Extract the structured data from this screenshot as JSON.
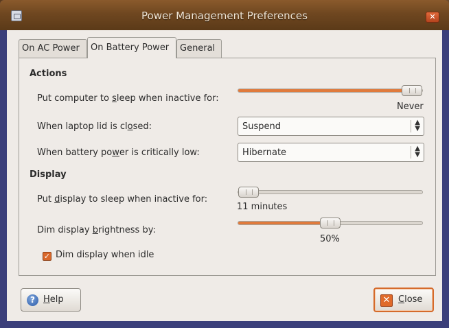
{
  "window": {
    "title": "Power Management Preferences",
    "close_glyph": "✕"
  },
  "tabs": [
    {
      "label": "On AC Power"
    },
    {
      "label": "On Battery Power"
    },
    {
      "label": "General"
    }
  ],
  "actions": {
    "heading": "Actions",
    "sleep": {
      "label_pre": "Put computer to ",
      "label_u": "s",
      "label_post": "leep when inactive for:",
      "value": "Never",
      "level": 1.0
    },
    "lid": {
      "label_pre": "When laptop lid is cl",
      "label_u": "o",
      "label_post": "sed:",
      "selected": "Suspend"
    },
    "critical": {
      "label_pre": "When battery po",
      "label_u": "w",
      "label_post": "er is critically low:",
      "selected": "Hibernate"
    }
  },
  "display": {
    "heading": "Display",
    "sleep": {
      "label_pre": "Put ",
      "label_u": "d",
      "label_post": "isplay to sleep when inactive for:",
      "value": "11 minutes",
      "level": 0.0
    },
    "dim": {
      "label_pre": "Dim display ",
      "label_u": "b",
      "label_post": "rightness by:",
      "value": "50%",
      "level": 0.5
    },
    "idle": {
      "label": "Dim display when idle",
      "checked": true,
      "check_glyph": "✓"
    }
  },
  "buttons": {
    "help_pre": "",
    "help_u": "H",
    "help_post": "elp",
    "help_icon_glyph": "?",
    "close_pre": "",
    "close_u": "C",
    "close_post": "lose",
    "close_icon_glyph": "✕"
  },
  "colors": {
    "accent": "#e07a3c",
    "titlebar": "#6f4720"
  }
}
